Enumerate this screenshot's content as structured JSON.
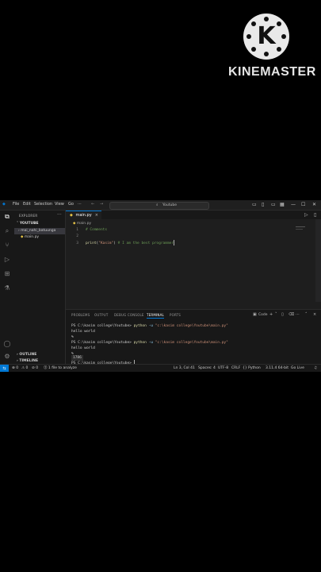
{
  "watermark": {
    "text": "KINEMASTER",
    "logo_letter": "K"
  },
  "titlebar": {
    "menus": [
      "File",
      "Edit",
      "Selection",
      "View",
      "Go",
      "···"
    ],
    "nav": [
      "←",
      "→"
    ],
    "search_text": "Youtube",
    "window_buttons": [
      "—",
      "☐",
      "✕"
    ]
  },
  "sidebar": {
    "header": "EXPLORER",
    "folder": "YOUTUBE",
    "items": [
      "mai_nahi_batuunga",
      "main.py"
    ],
    "bottom": [
      "OUTLINE",
      "TIMELINE"
    ]
  },
  "editor": {
    "tab_label": "main.py",
    "breadcrumb": "main.py",
    "lines": [
      {
        "no": "1",
        "text": "# Comments"
      },
      {
        "no": "2",
        "text": ""
      },
      {
        "no": "3",
        "fn": "print",
        "open": "(",
        "str": "\"Kasim\"",
        "close": ")",
        "comment": " # I am the best programmer"
      }
    ]
  },
  "panel": {
    "tabs": [
      "PROBLEMS",
      "OUTPUT",
      "DEBUG CONSOLE",
      "TERMINAL",
      "PORTS"
    ],
    "active_tab": "TERMINAL",
    "shell_label": "Code",
    "terminal": {
      "prompt": "PS C:\\kasim college\\Youtube>",
      "cmd": "python",
      "arg": "-u",
      "path": "\"c:\\kasim college\\Youtube\\main.py\"",
      "output": "hello world",
      "aside": "%",
      "input": "1786"
    }
  },
  "status": {
    "left": [
      "⊗ 0",
      "⚠ 0",
      "⊘ 0",
      "⓵ 1 file to analyze"
    ],
    "right": [
      "Ln 3, Col 41",
      "Spaces: 4",
      "UTF-8",
      "CRLF",
      "{} Python",
      "3.11.4 64-bit",
      "Go Live"
    ]
  },
  "colors": {
    "accent": "#0078d4",
    "background": "#1e1e1e",
    "comment": "#6a9955",
    "string": "#ce9178",
    "function": "#dcdcaa"
  }
}
